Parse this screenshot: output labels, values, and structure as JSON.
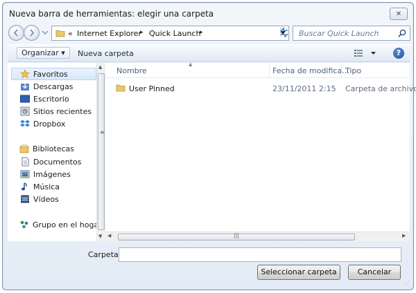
{
  "window": {
    "title": "Nueva barra de herramientas: elegir una carpeta",
    "close_symbol": "✕"
  },
  "address_bar": {
    "overflow": "«",
    "crumbs": [
      "Internet Explorer",
      "Quick Launch"
    ],
    "separator": "▸"
  },
  "search": {
    "placeholder": "Buscar Quick Launch"
  },
  "toolbar": {
    "organize_label": "Organizar ▾",
    "new_folder_label": "Nueva carpeta",
    "help_symbol": "?"
  },
  "sidebar": {
    "favorites": {
      "label": "Favoritos",
      "icon": "star-icon",
      "items": [
        {
          "label": "Descargas",
          "icon": "downloads-folder-icon"
        },
        {
          "label": "Escritorio",
          "icon": "desktop-icon"
        },
        {
          "label": "Sitios recientes",
          "icon": "recent-places-icon"
        },
        {
          "label": "Dropbox",
          "icon": "dropbox-icon"
        }
      ]
    },
    "libraries": {
      "label": "Bibliotecas",
      "icon": "libraries-icon",
      "items": [
        {
          "label": "Documentos",
          "icon": "documents-icon"
        },
        {
          "label": "Imágenes",
          "icon": "pictures-icon"
        },
        {
          "label": "Música",
          "icon": "music-icon"
        },
        {
          "label": "Vídeos",
          "icon": "videos-icon"
        }
      ]
    },
    "homegroup": {
      "label": "Grupo en el hogar",
      "icon": "homegroup-icon"
    }
  },
  "file_list": {
    "columns": [
      "Nombre",
      "Fecha de modifica...",
      "Tipo"
    ],
    "rows": [
      {
        "name": "User Pinned",
        "date": "23/11/2011 2:15",
        "type": "Carpeta de archivos",
        "icon": "folder-icon"
      }
    ]
  },
  "footer": {
    "folder_label": "Carpeta:",
    "folder_value": "",
    "select_button": "Seleccionar carpeta",
    "cancel_button": "Cancelar"
  },
  "colors": {
    "accent": "#1c4f9e",
    "folder": "#e8c86a",
    "selection": "#d6e8fb"
  }
}
